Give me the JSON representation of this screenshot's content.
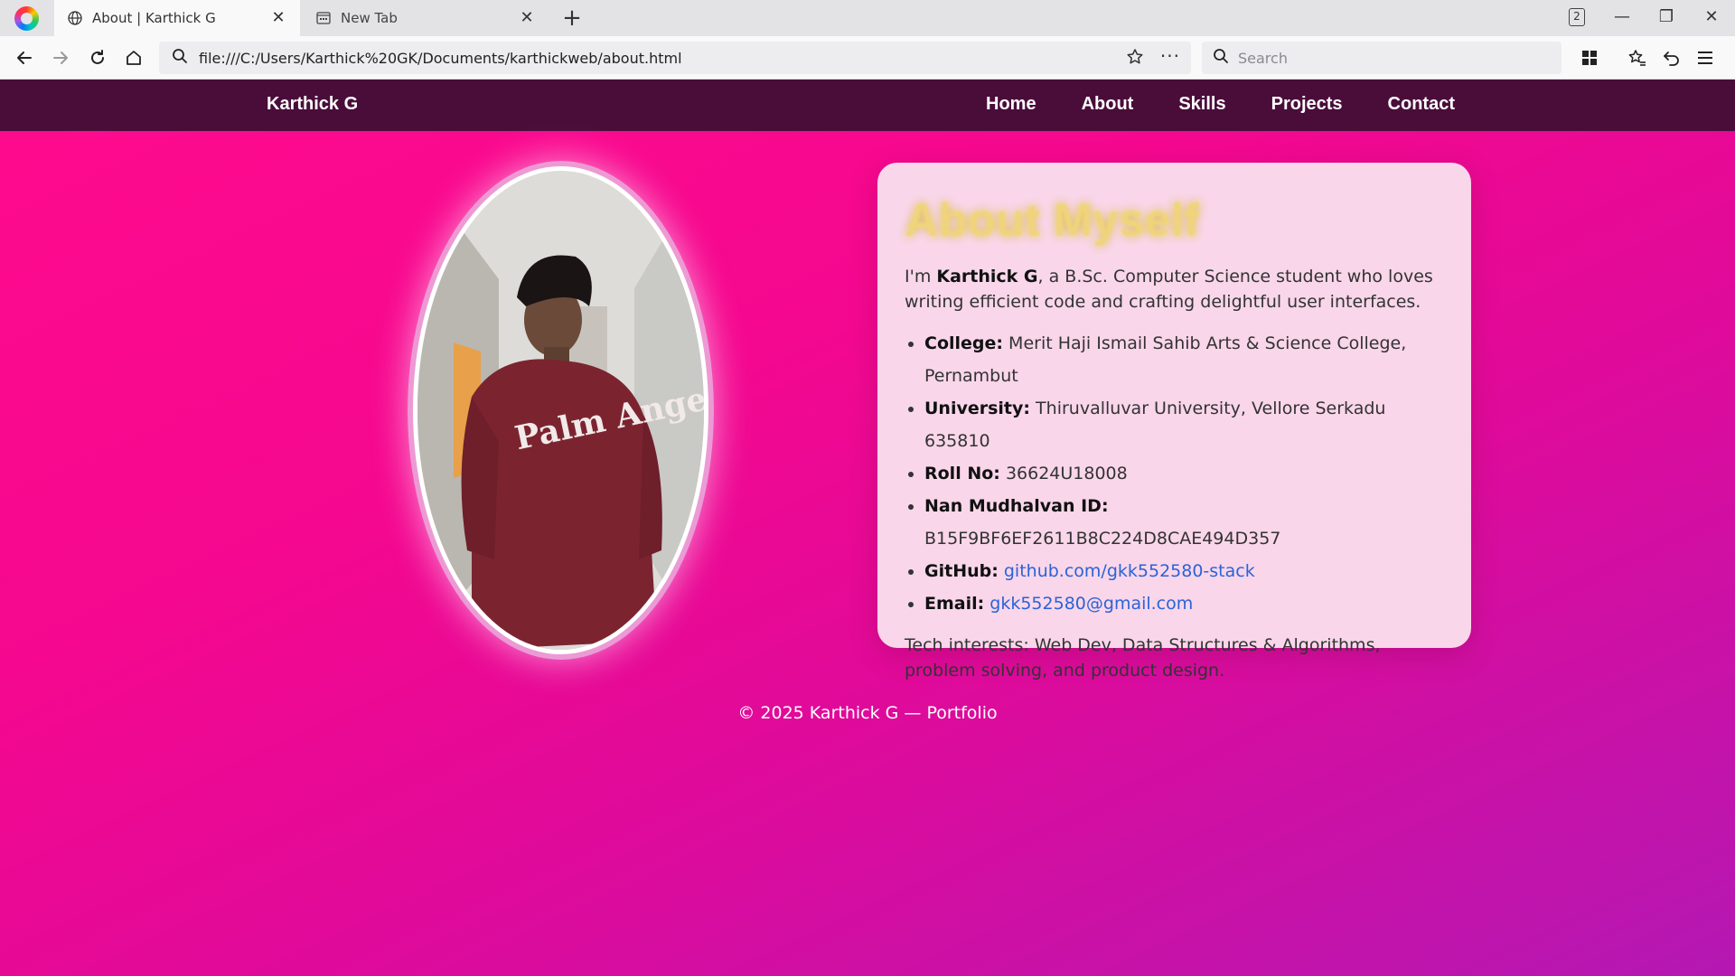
{
  "browser": {
    "tabs": [
      {
        "label": "About | Karthick G",
        "icon": "globe-icon",
        "active": true
      },
      {
        "label": "New Tab",
        "icon": "newtab-icon",
        "active": false
      }
    ],
    "tab_count": "2",
    "url": "file:///C:/Users/Karthick%20GK/Documents/karthickweb/about.html",
    "search_placeholder": "Search"
  },
  "site": {
    "brand": "Karthick G",
    "nav": [
      "Home",
      "About",
      "Skills",
      "Projects",
      "Contact"
    ]
  },
  "about": {
    "title": "About Myself",
    "intro_prefix": "I'm ",
    "intro_name": "Karthick G",
    "intro_suffix": ", a B.Sc. Computer Science student who loves writing efficient code and crafting delightful user interfaces.",
    "details": [
      {
        "label": "College:",
        "value": "Merit Haji Ismail Sahib Arts & Science College, Pernambut"
      },
      {
        "label": "University:",
        "value": "Thiruvalluvar University, Vellore Serkadu 635810"
      },
      {
        "label": "Roll No:",
        "value": "36624U18008"
      },
      {
        "label": "Nan Mudhalvan ID:",
        "value": "B15F9BF6EF2611B8C224D8CAE494D357"
      },
      {
        "label": "GitHub:",
        "link": "github.com/gkk552580-stack"
      },
      {
        "label": "Email:",
        "link": "gkk552580@gmail.com"
      }
    ],
    "outro": "Tech interests: Web Dev, Data Structures & Algorithms, problem solving, and product design."
  },
  "footer": "© 2025 Karthick G — Portfolio",
  "photo": {
    "shirt_text": "Palm Angels"
  },
  "colors": {
    "header": "#4a0d3a",
    "card": "#f9d6ea",
    "link": "#2a63d6",
    "gradient_start": "#ff0a8d",
    "gradient_end": "#b418b3"
  }
}
